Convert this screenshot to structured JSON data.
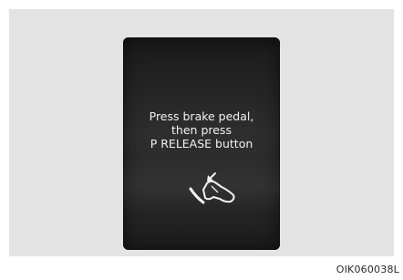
{
  "display": {
    "message_lines": [
      "Press brake pedal,",
      "then press",
      "P RELEASE button"
    ],
    "icon": "brake-pedal-press-icon"
  },
  "figure_code": "OIK060038L"
}
